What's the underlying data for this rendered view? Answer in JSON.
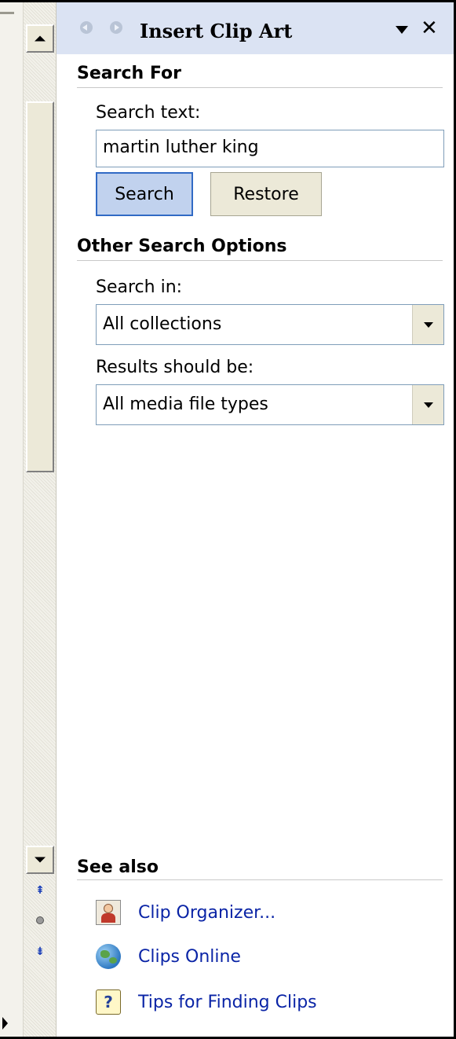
{
  "pane": {
    "title": "Insert Clip Art"
  },
  "search_for": {
    "heading": "Search For",
    "label": "Search text:",
    "value": "martin luther king",
    "search_button": "Search",
    "restore_button": "Restore"
  },
  "other_options": {
    "heading": "Other Search Options",
    "search_in_label": "Search in:",
    "search_in_value": "All collections",
    "results_label": "Results should be:",
    "results_value": "All media file types"
  },
  "see_also": {
    "heading": "See also",
    "links": [
      {
        "label": "Clip Organizer...",
        "icon": "clip-organizer-icon"
      },
      {
        "label": "Clips Online",
        "icon": "globe-icon"
      },
      {
        "label": "Tips for Finding Clips",
        "icon": "help-icon"
      }
    ]
  },
  "icons": {
    "back": "back-arrow-icon",
    "forward": "forward-arrow-icon",
    "menu": "chevron-down-icon",
    "close": "close-icon"
  },
  "colors": {
    "titlebar": "#dbe3f3",
    "link": "#0a24a6",
    "search_button_bg": "#c1d2ee",
    "search_button_border": "#316ac5"
  }
}
